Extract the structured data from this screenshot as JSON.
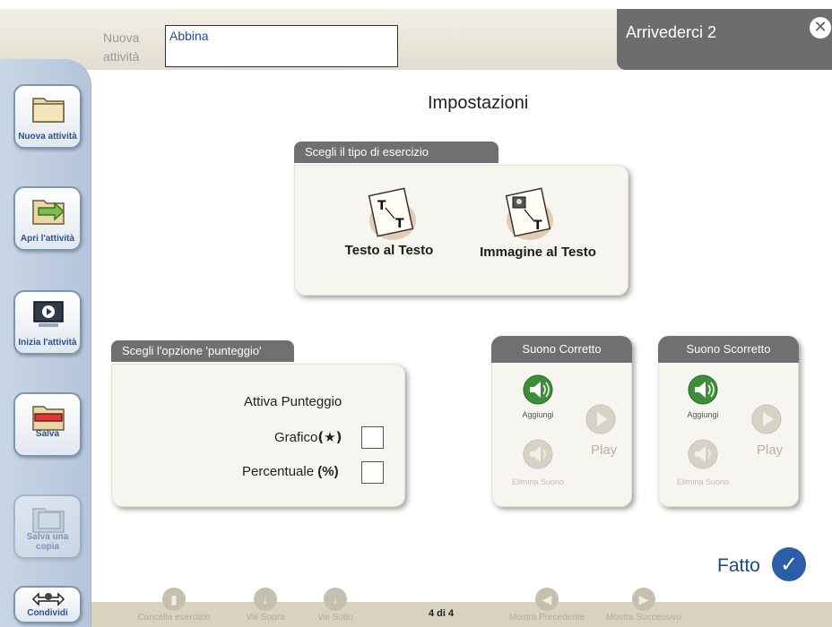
{
  "header": {
    "new_activity_label": "Nuova attività",
    "activity_name_value": "Abbina",
    "window_title": "Arrivederci 2",
    "close_icon": "close-icon"
  },
  "sidebar": {
    "items": [
      {
        "label": "Nuova attività",
        "icon": "folder-icon"
      },
      {
        "label": "Apri l'attività",
        "icon": "open-folder-icon"
      },
      {
        "label": "Inizia l'attività",
        "icon": "play-monitor-icon"
      },
      {
        "label": "Salva",
        "icon": "save-folder-icon"
      },
      {
        "label": "Salva una copia",
        "icon": "save-copy-icon"
      },
      {
        "label": "Condividi",
        "icon": "share-icon"
      }
    ]
  },
  "main": {
    "title": "Impostazioni",
    "exercise_type": {
      "tab_label": "Scegli il tipo di esercizio",
      "options": [
        {
          "label": "Testo al Testo",
          "icon": "text-to-text-icon"
        },
        {
          "label": "Immagine al Testo",
          "icon": "image-to-text-icon"
        }
      ]
    },
    "score": {
      "tab_label": "Scegli l'opzione 'punteggio'",
      "heading": "Attiva Punteggio",
      "graphic_label": "Grafico",
      "graphic_symbol": "(★)",
      "percent_label": "Percentuale",
      "percent_symbol": "(%)"
    },
    "sound_correct": {
      "title": "Suono Corretto",
      "add_label": "Aggiungi",
      "play_label": "Play",
      "delete_label": "Elimina Suono"
    },
    "sound_wrong": {
      "title": "Suono Scorretto",
      "add_label": "Aggiungi",
      "play_label": "Play",
      "delete_label": "Elimina Suono"
    },
    "done_label": "Fatto"
  },
  "bottom": {
    "items": [
      {
        "label": "Cancella esercizio"
      },
      {
        "label": "Vai Sopra"
      },
      {
        "label": "Vai Sotto"
      },
      {
        "label": "Mostra Precedente"
      },
      {
        "label": "Mostra Successivo"
      }
    ],
    "page_indicator": "4 di 4"
  },
  "colors": {
    "sidebar_bg": "#b4c4d9",
    "tab_bg": "#6e7072",
    "accent_blue": "#2a5fa8",
    "sound_green": "#3f8f3a"
  }
}
